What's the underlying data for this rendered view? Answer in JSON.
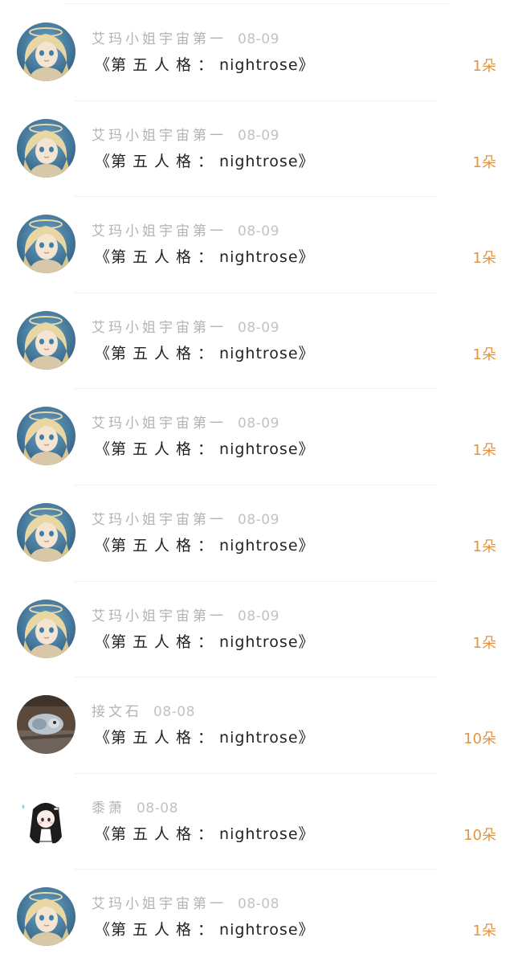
{
  "items": [
    {
      "avatar": "blonde-girl-avatar",
      "user": "艾玛小姐宇宙第一",
      "date": "08-09",
      "gift_open": "《",
      "gift_title": "第五人格：",
      "gift_latin": "nightrose",
      "gift_close": "》",
      "count": "1朵"
    },
    {
      "avatar": "blonde-girl-avatar",
      "user": "艾玛小姐宇宙第一",
      "date": "08-09",
      "gift_open": "《",
      "gift_title": "第五人格：",
      "gift_latin": "nightrose",
      "gift_close": "》",
      "count": "1朵"
    },
    {
      "avatar": "blonde-girl-avatar",
      "user": "艾玛小姐宇宙第一",
      "date": "08-09",
      "gift_open": "《",
      "gift_title": "第五人格：",
      "gift_latin": "nightrose",
      "gift_close": "》",
      "count": "1朵"
    },
    {
      "avatar": "blonde-girl-avatar",
      "user": "艾玛小姐宇宙第一",
      "date": "08-09",
      "gift_open": "《",
      "gift_title": "第五人格：",
      "gift_latin": "nightrose",
      "gift_close": "》",
      "count": "1朵"
    },
    {
      "avatar": "blonde-girl-avatar",
      "user": "艾玛小姐宇宙第一",
      "date": "08-09",
      "gift_open": "《",
      "gift_title": "第五人格：",
      "gift_latin": "nightrose",
      "gift_close": "》",
      "count": "1朵"
    },
    {
      "avatar": "blonde-girl-avatar",
      "user": "艾玛小姐宇宙第一",
      "date": "08-09",
      "gift_open": "《",
      "gift_title": "第五人格：",
      "gift_latin": "nightrose",
      "gift_close": "》",
      "count": "1朵"
    },
    {
      "avatar": "blonde-girl-avatar",
      "user": "艾玛小姐宇宙第一",
      "date": "08-09",
      "gift_open": "《",
      "gift_title": "第五人格：",
      "gift_latin": "nightrose",
      "gift_close": "》",
      "count": "1朵"
    },
    {
      "avatar": "cat-photo-avatar",
      "user": "接文石",
      "date": "08-08",
      "gift_open": "《",
      "gift_title": "第五人格：",
      "gift_latin": "nightrose",
      "gift_close": "》",
      "count": "10朵"
    },
    {
      "avatar": "chibi-girl-avatar",
      "user": "黍萧",
      "date": "08-08",
      "gift_open": "《",
      "gift_title": "第五人格：",
      "gift_latin": "nightrose",
      "gift_close": "》",
      "count": "10朵"
    },
    {
      "avatar": "blonde-girl-avatar",
      "user": "艾玛小姐宇宙第一",
      "date": "08-08",
      "gift_open": "《",
      "gift_title": "第五人格：",
      "gift_latin": "nightrose",
      "gift_close": "》",
      "count": "1朵"
    }
  ],
  "colors": {
    "username": "#b3b3b3",
    "date": "#c2c2c2",
    "gift_text": "#222222",
    "count": "#e2943f",
    "divider": "#f1f1f1"
  }
}
